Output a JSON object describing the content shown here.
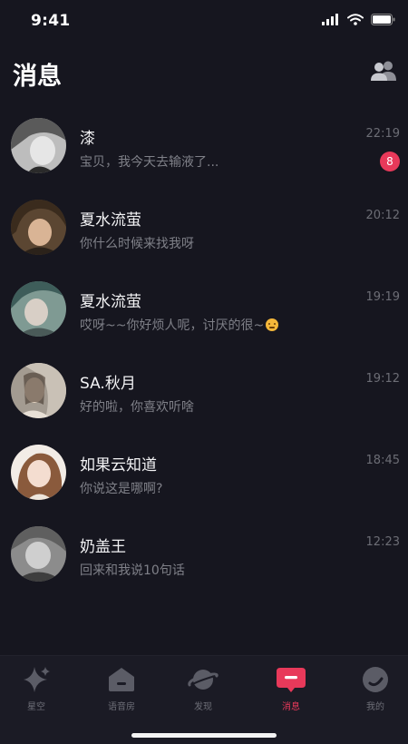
{
  "status_bar": {
    "time": "9:41"
  },
  "header": {
    "title": "消息"
  },
  "conversations": [
    {
      "name": "漆",
      "preview": "宝贝，我今天去输液了...",
      "time": "22:19",
      "unread": "8"
    },
    {
      "name": "夏水流萤",
      "preview": "你什么时候来找我呀",
      "time": "20:12"
    },
    {
      "name": "夏水流萤",
      "preview": "哎呀~~你好烦人呢，讨厌的很~",
      "time": "19:19"
    },
    {
      "name": "SA.秋月",
      "preview": "好的啦，你喜欢听啥",
      "time": "19:12"
    },
    {
      "name": "如果云知道",
      "preview": "你说这是哪啊?",
      "time": "18:45"
    },
    {
      "name": "奶盖王",
      "preview": "回来和我说10句话",
      "time": "12:23"
    }
  ],
  "tabs": [
    {
      "label": "星空",
      "icon": "sparkle-icon"
    },
    {
      "label": "语音房",
      "icon": "house-icon"
    },
    {
      "label": "发现",
      "icon": "planet-icon"
    },
    {
      "label": "消息",
      "icon": "chat-bubble-icon",
      "active": true
    },
    {
      "label": "我的",
      "icon": "profile-icon"
    }
  ],
  "colors": {
    "background": "#16161f",
    "accent": "#e8395a",
    "tabbar": "#1b1b25"
  }
}
